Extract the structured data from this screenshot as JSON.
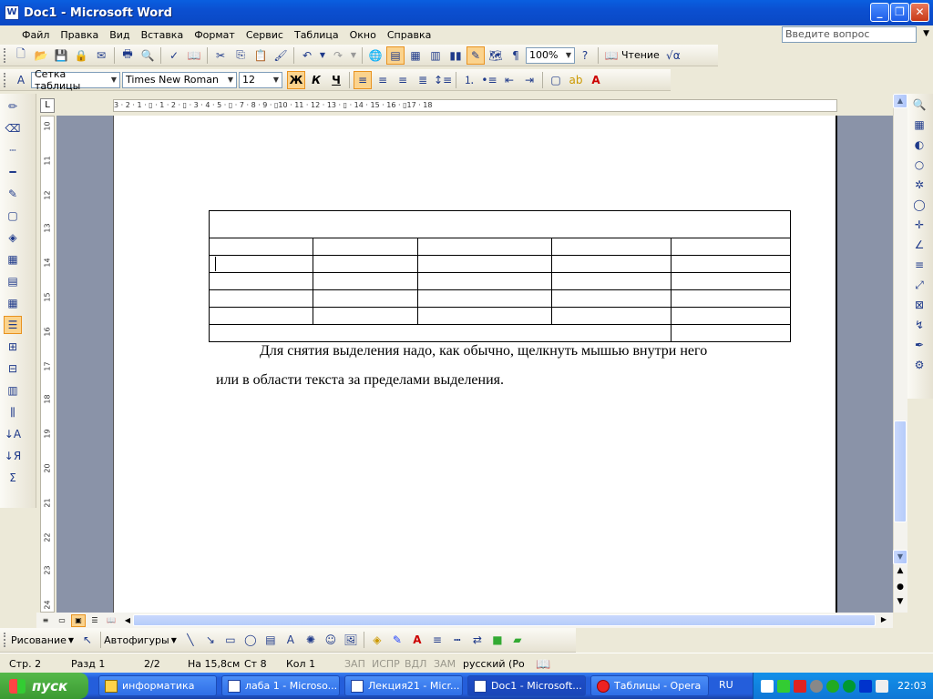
{
  "window": {
    "title": "Doc1 - Microsoft Word",
    "icon": "word-doc-icon"
  },
  "window_buttons": {
    "minimize": "_",
    "restore": "❐",
    "close": "✕"
  },
  "menu": [
    "Файл",
    "Правка",
    "Вид",
    "Вставка",
    "Формат",
    "Сервис",
    "Таблица",
    "Окно",
    "Справка"
  ],
  "ask": {
    "placeholder": "Введите вопрос"
  },
  "standard_toolbar": {
    "zoom": "100%",
    "reading_label": "Чтение"
  },
  "format_toolbar": {
    "style": "Сетка таблицы",
    "font": "Times New Roman",
    "size": "12",
    "bold": "Ж",
    "italic": "К",
    "underline": "Ч"
  },
  "ruler": {
    "h_labels": "3 · 2 · 1 · ▯ · 1 · 2 · ▯ · 3 · 4 · 5 · ▯ · 7 · 8 · 9 · ▯10 · 11 · 12 · 13 · ▯ · 14 · 15 · 16 · ▯17 · 18",
    "v_labels": [
      "10",
      "11",
      "12",
      "13",
      "14",
      "15",
      "16",
      "17",
      "18",
      "19",
      "20",
      "21",
      "22",
      "23",
      "24"
    ]
  },
  "document": {
    "line1": "Для снятия выделения надо, как обычно, щелкнуть мышью внутри него",
    "line2": "или в области текста за пределами выделения."
  },
  "draw_toolbar": {
    "drawing": "Рисование",
    "autoshapes": "Автофигуры"
  },
  "status": {
    "page": "Стр. 2",
    "section": "Разд 1",
    "pages": "2/2",
    "at": "На 15,8см",
    "line": "Ст 8",
    "col": "Кол 1",
    "rec": "ЗАП",
    "trk": "ИСПР",
    "ext": "ВДЛ",
    "ovr": "ЗАМ",
    "lang": "русский (Ро"
  },
  "taskbar": {
    "start": "пуск",
    "tasks": [
      {
        "label": "информатика"
      },
      {
        "label": "лаба 1 - Microso..."
      },
      {
        "label": "Лекция21 - Micr..."
      },
      {
        "label": "Doc1 - Microsoft..."
      },
      {
        "label": "Таблицы - Opera"
      }
    ],
    "lang": "RU",
    "clock": "22:03"
  }
}
